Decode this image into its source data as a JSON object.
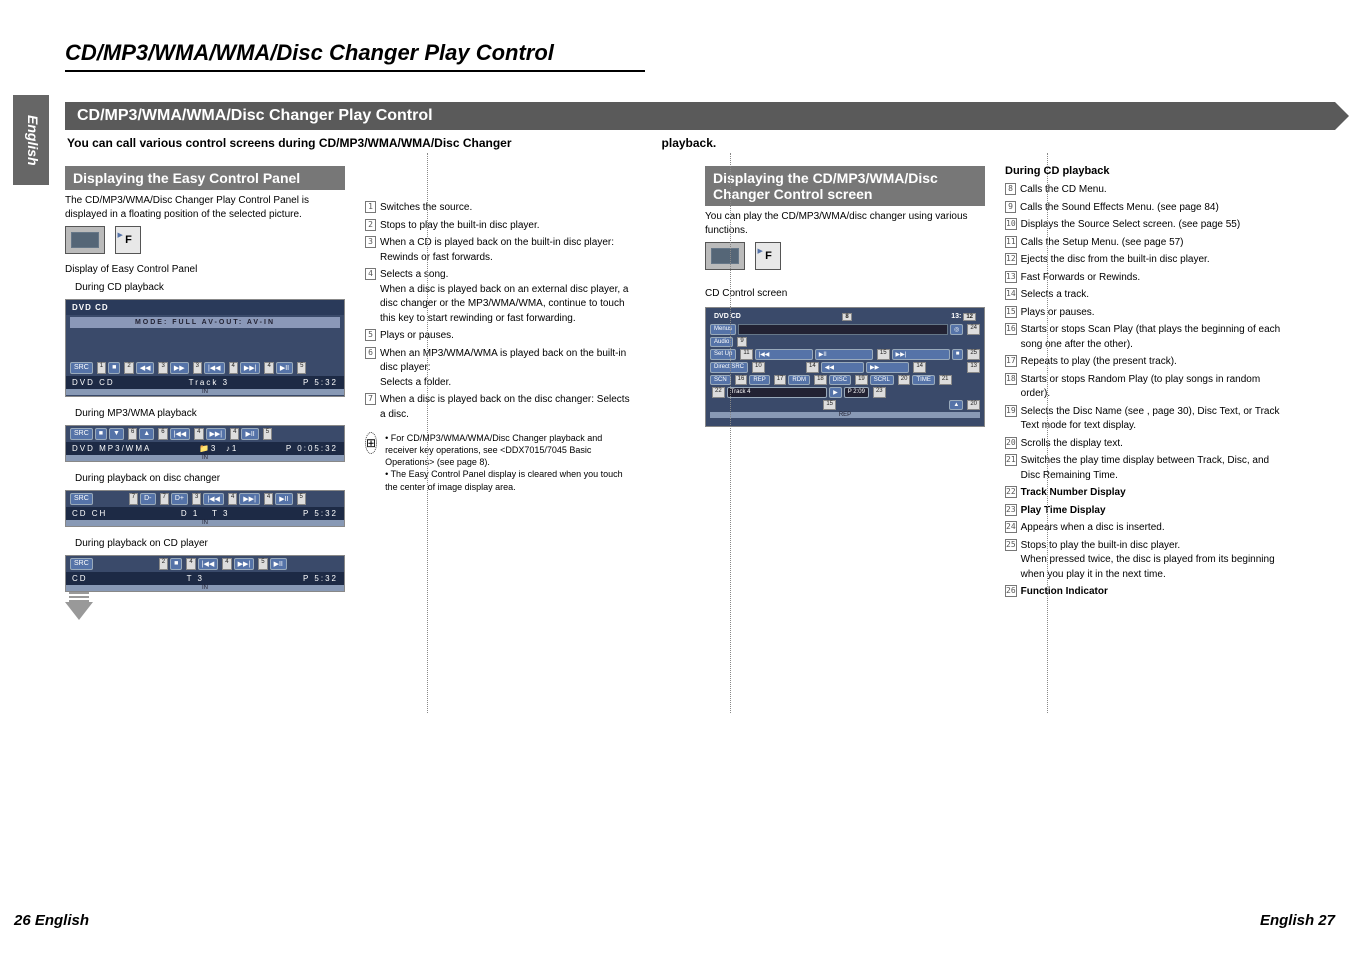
{
  "lang_tab": "English",
  "page_title": "CD/MP3/WMA/WMA/Disc Changer Play Control",
  "section_bar": "CD/MP3/WMA/WMA/Disc Changer Play Control",
  "intro_left": "You can call various control screens during CD/MP3/WMA/WMA/Disc Changer",
  "intro_right": "playback.",
  "footer_left": "26 English",
  "footer_right": "English 27",
  "left": {
    "h": "Displaying the Easy Control Panel",
    "p1": "The CD/MP3/WMA/Disc Changer Play Control Panel is displayed in a floating position of the selected picture.",
    "cap_display": "Display of Easy Control Panel",
    "cap_cd": "During CD playback",
    "cap_mp3": "During MP3/WMA playback",
    "cap_chg": "During playback on disc changer",
    "cap_cdp": "During playback on CD player",
    "panel_cd": {
      "title": "DVD CD",
      "mode": "MODE: FULL   AV-OUT: AV-IN",
      "track": "Track 3",
      "time": "P   5:32"
    },
    "panel_mp3": {
      "title": "DVD MP3/WMA",
      "folder": "3",
      "track": "1",
      "time": "P 0:05:32"
    },
    "panel_chg": {
      "title": "CD CH",
      "disc": "D 1",
      "track": "T 3",
      "time": "P   5:32"
    },
    "panel_cdp": {
      "title": "CD",
      "track": "T 3",
      "time": "P   5:32"
    }
  },
  "mid": {
    "items": [
      {
        "n": "1",
        "t": "Switches the source."
      },
      {
        "n": "2",
        "t": "Stops to play the built-in disc player."
      },
      {
        "n": "3",
        "t": "When a CD is played back on the built-in disc player: Rewinds or fast forwards."
      },
      {
        "n": "4",
        "t": "Selects a song.\nWhen a disc is played back on an external disc player, a disc changer or the MP3/WMA/WMA, continue to touch this key to start rewinding or fast forwarding."
      },
      {
        "n": "5",
        "t": "Plays or pauses."
      },
      {
        "n": "6",
        "t": "When an MP3/WMA/WMA is played back on the built-in disc player:\nSelects a folder."
      },
      {
        "n": "7",
        "t": "When a disc is played back on the disc changer: Selects a disc."
      }
    ],
    "note1": "For CD/MP3/WMA/WMA/Disc Changer playback and receiver key operations, see <DDX7015/7045 Basic Operations> (see page 8).",
    "note2": "The Easy Control Panel display is cleared when you touch the center of image display area."
  },
  "right1": {
    "h": "Displaying the CD/MP3/WMA/Disc Changer Control screen",
    "p": "You can play the CD/MP3/WMA/disc changer using various functions.",
    "cap": "CD Control screen",
    "screen": {
      "title": "DVD CD",
      "time_right": "13:",
      "menus": "Menus",
      "audio": "Audio",
      "setup": "Set Up",
      "direct": "Direct SRC",
      "row_btns": [
        "SCN",
        "REP",
        "RDM",
        "DISC",
        "SCRL",
        "TIME"
      ],
      "track": "Track 4",
      "play": "P  2:09",
      "rep": "REP"
    }
  },
  "right2": {
    "h": "During CD playback",
    "items": [
      {
        "n": "8",
        "t": "Calls the CD Menu."
      },
      {
        "n": "9",
        "t": "Calls the Sound Effects Menu. (see page 84)"
      },
      {
        "n": "10",
        "t": "Displays the Source Select screen. (see page 55)"
      },
      {
        "n": "11",
        "t": "Calls the Setup Menu. (see page 57)"
      },
      {
        "n": "12",
        "t": "Ejects the disc from the built-in disc player."
      },
      {
        "n": "13",
        "t": "Fast Forwards or Rewinds."
      },
      {
        "n": "14",
        "t": "Selects a track."
      },
      {
        "n": "15",
        "t": "Plays or pauses."
      },
      {
        "n": "16",
        "t": "Starts or stops Scan Play (that plays the beginning of each song one after the other)."
      },
      {
        "n": "17",
        "t": "Repeats to play (the present track)."
      },
      {
        "n": "18",
        "t": "Starts or stops Random Play (to play songs in random order)."
      },
      {
        "n": "19",
        "t": "Selects the Disc Name (see <Set Disc Name>, page 30), Disc Text, or Track Text mode for text display."
      },
      {
        "n": "20",
        "t": "Scrolls the display text."
      },
      {
        "n": "21",
        "t": "Switches the play time display between Track, Disc, and Disc Remaining Time."
      },
      {
        "n": "22",
        "t": "Track Number Display",
        "b": true
      },
      {
        "n": "23",
        "t": "Play Time Display",
        "b": true
      },
      {
        "n": "24",
        "t": "Appears when a disc is inserted."
      },
      {
        "n": "25",
        "t": "Stops to play the built-in disc player.\nWhen pressed twice, the disc is played from its beginning when you play it in the next time."
      },
      {
        "n": "26",
        "t": "Function Indicator",
        "b": true
      }
    ]
  },
  "icons": {
    "prev": "|◀◀",
    "next": "▶▶|",
    "rew": "◀◀",
    "ff": "▶▶",
    "stop": "■",
    "play": "▶II",
    "src": "SRC",
    "fld_up": "▲",
    "fld_dn": "▼",
    "dup": "D+",
    "ddn": "D-"
  }
}
